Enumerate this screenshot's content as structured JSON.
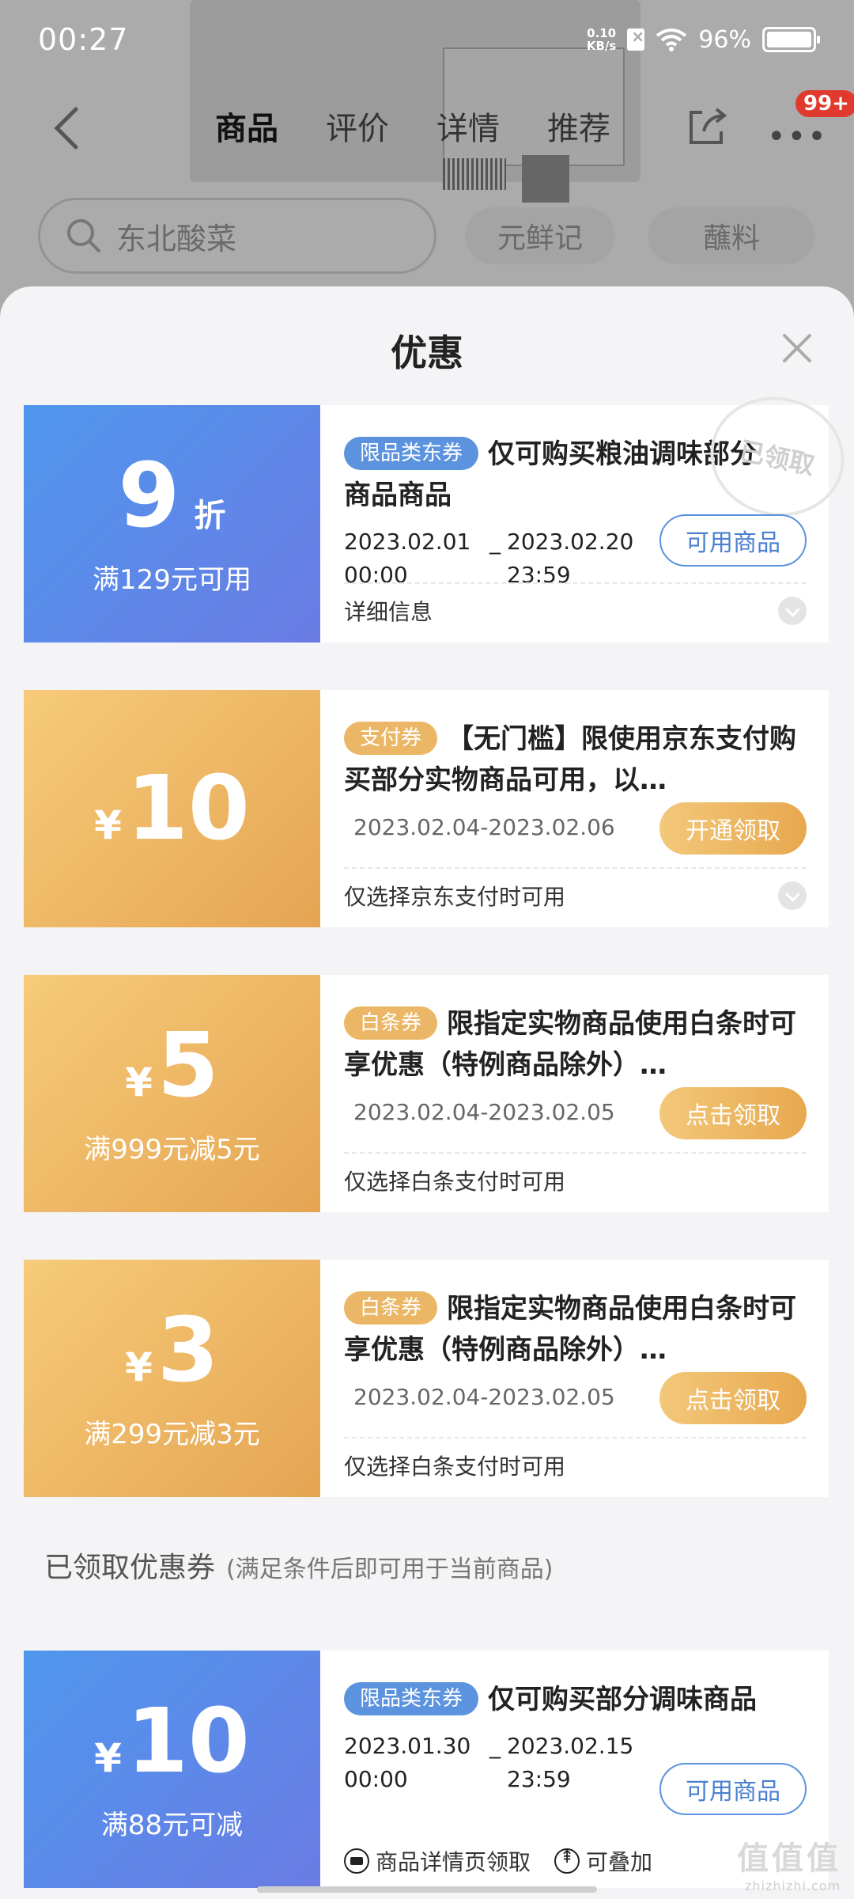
{
  "status_bar": {
    "time": "00:27",
    "net_speed_value": "0.10",
    "net_speed_unit": "KB/s",
    "battery": "96%"
  },
  "nav": {
    "tabs": [
      "商品",
      "评价",
      "详情",
      "推荐"
    ],
    "active_tab": "商品",
    "badge": "99+"
  },
  "search": {
    "placeholder": "东北酸菜",
    "chips": [
      "元鲜记",
      "蘸料"
    ]
  },
  "sheet": {
    "title": "优惠",
    "coupons": [
      {
        "amount_num": "9",
        "amount_unit": "折",
        "condition": "满129元可用",
        "tag": "限品类东券",
        "title": "仅可购买粮油调味部分商品商品",
        "date_start": "2023.02.01",
        "date_end": "2023.02.20",
        "time_start": "00:00",
        "time_end": "23:59",
        "date_sep": "_",
        "button": "可用商品",
        "footer": "详细信息",
        "stamp": "已领取"
      },
      {
        "yen": "¥",
        "amount_num": "10",
        "tag": "支付券",
        "title": "【无门槛】限使用京东支付购买部分实物商品可用，以…",
        "date_range": "2023.02.04-2023.02.06",
        "button": "开通领取",
        "footer": "仅选择京东支付时可用"
      },
      {
        "yen": "¥",
        "amount_num": "5",
        "condition": "满999元减5元",
        "tag": "白条券",
        "title": "限指定实物商品使用白条时可享优惠（特例商品除外）…",
        "date_range": "2023.02.04-2023.02.05",
        "button": "点击领取",
        "footer": "仅选择白条支付时可用"
      },
      {
        "yen": "¥",
        "amount_num": "3",
        "condition": "满299元减3元",
        "tag": "白条券",
        "title": "限指定实物商品使用白条时可享优惠（特例商品除外）…",
        "date_range": "2023.02.04-2023.02.05",
        "button": "点击领取",
        "footer": "仅选择白条支付时可用"
      }
    ],
    "claimed_section": {
      "title": "已领取优惠券",
      "subtitle": "(满足条件后即可用于当前商品)"
    },
    "claimed_coupon": {
      "yen": "¥",
      "amount_num": "10",
      "condition": "满88元可减",
      "tag": "限品类东券",
      "title": "仅可购买部分调味商品",
      "date_start": "2023.01.30",
      "date_end": "2023.02.15",
      "time_start": "00:00",
      "time_end": "23:59",
      "date_sep": "_",
      "button": "可用商品",
      "foot_left": "商品详情页领取",
      "foot_right": "可叠加"
    }
  },
  "watermark": {
    "text": "值值值",
    "small": "zhizhizhi.com"
  },
  "colors": {
    "blue_coupon": "#4f97ee",
    "gold_coupon": "#e5a553",
    "accent_blue": "#5b93df",
    "badge_red": "#e03a2f"
  }
}
